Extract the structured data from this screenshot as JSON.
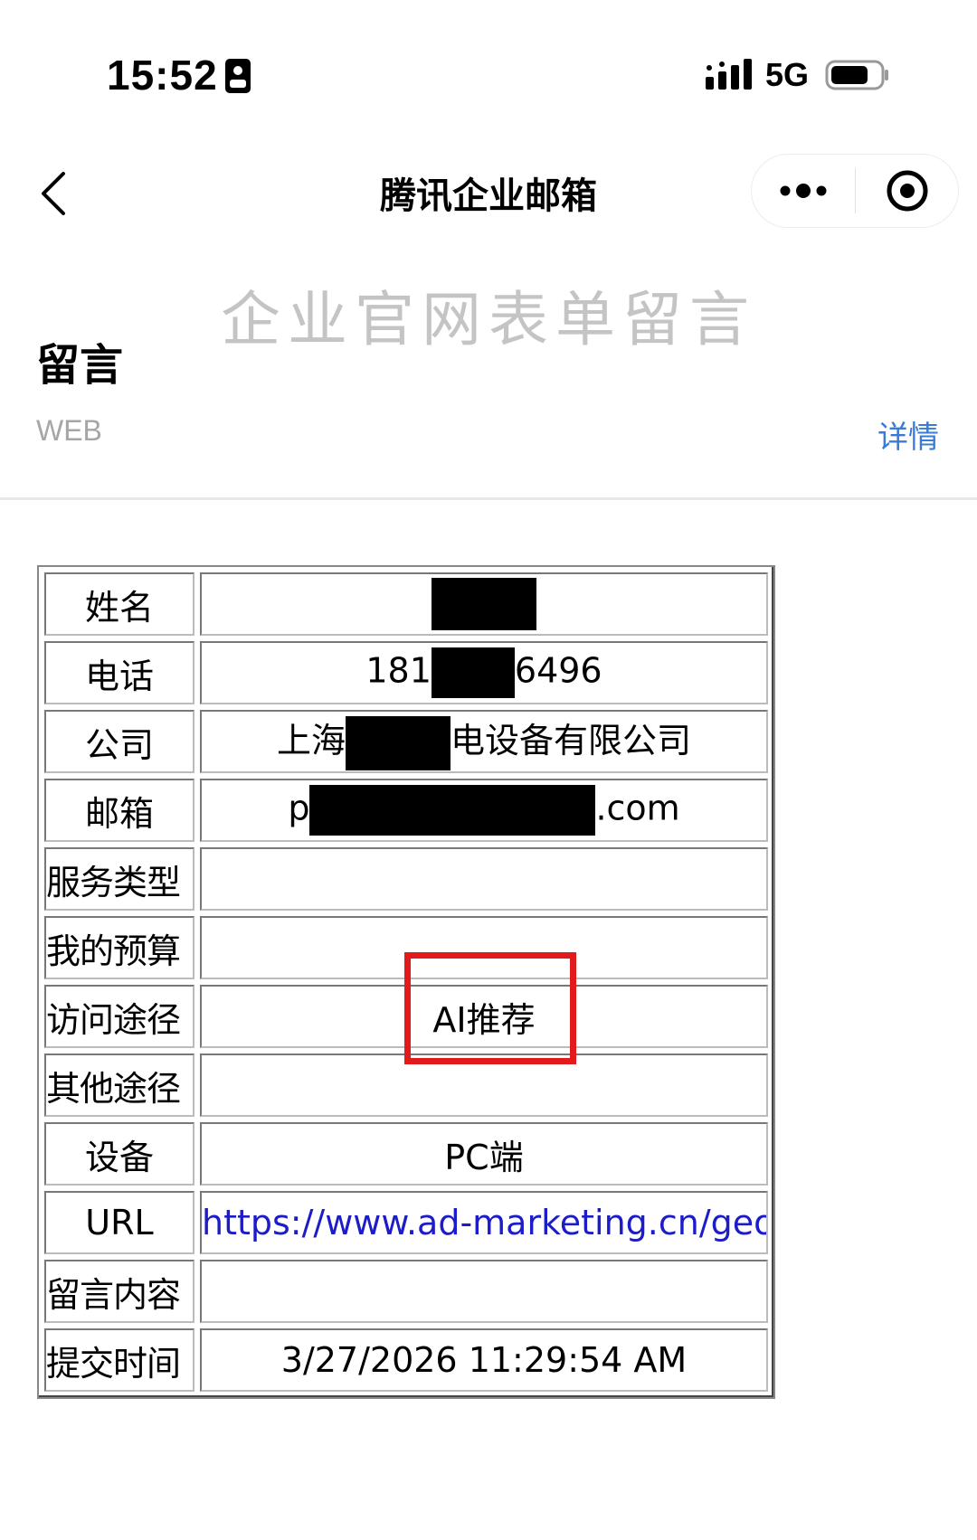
{
  "status_bar": {
    "time": "15:52",
    "network": "5G",
    "icons": [
      "id-card-icon",
      "signal-icon",
      "battery-icon"
    ]
  },
  "nav": {
    "title": "腾讯企业邮箱",
    "icons": [
      "back-icon",
      "more-icon",
      "close-mini-program-icon"
    ]
  },
  "header": {
    "banner": "企业官网表单留言",
    "title": "留言",
    "source": "WEB",
    "detail_link": "详情"
  },
  "form": {
    "rows": [
      {
        "label": "姓名",
        "value": ""
      },
      {
        "label": "电话",
        "value_prefix": "181",
        "value_suffix": "6496"
      },
      {
        "label": "公司",
        "value_prefix": "上海",
        "value_suffix": "电设备有限公司"
      },
      {
        "label": "邮箱",
        "value_prefix": "p",
        "value_suffix": ".com"
      },
      {
        "label": "服务类型",
        "value": ""
      },
      {
        "label": "我的预算",
        "value": ""
      },
      {
        "label": "访问途径",
        "value": "AI推荐"
      },
      {
        "label": "其他途径",
        "value": ""
      },
      {
        "label": "设备",
        "value": "PC端"
      },
      {
        "label": "URL",
        "value": "https://www.ad-marketing.cn/geo/"
      },
      {
        "label": "留言内容",
        "value": ""
      },
      {
        "label": "提交时间",
        "value": "3/27/2026 11:29:54 AM"
      }
    ]
  },
  "colors": {
    "highlight": "#e11b1b",
    "link": "#1c1cc8",
    "detail_link": "#3a7bd5",
    "banner_text": "#c4c4c4"
  }
}
